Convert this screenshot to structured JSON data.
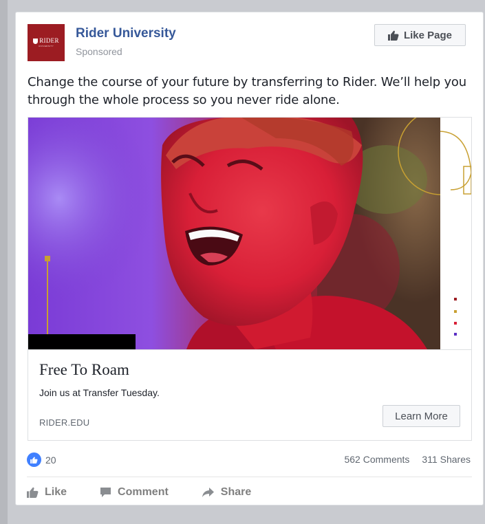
{
  "post": {
    "page_name": "Rider University",
    "sponsored": "Sponsored",
    "like_page_button": "Like Page",
    "text": "Change the course of your future by transferring to Rider. We’ll help you through the whole process so you never ride alone."
  },
  "logo": {
    "word": "RIDER",
    "sub": "UNIVERSITY",
    "color": "#9c1c22"
  },
  "ad": {
    "headline": "Free To Roam",
    "description": "Join us at Transfer Tuesday.",
    "domain": "RIDER.EDU",
    "cta": "Learn More",
    "image_description_icon": "laughing-student-with-color-powder-photo"
  },
  "engagement": {
    "reactions": "20",
    "comments": "562 Comments",
    "shares": "311 Shares"
  },
  "actions": {
    "like": "Like",
    "comment": "Comment",
    "share": "Share"
  },
  "colors": {
    "link_blue": "#365899",
    "reaction_blue": "#4080ff",
    "muted_text": "#90949c"
  }
}
